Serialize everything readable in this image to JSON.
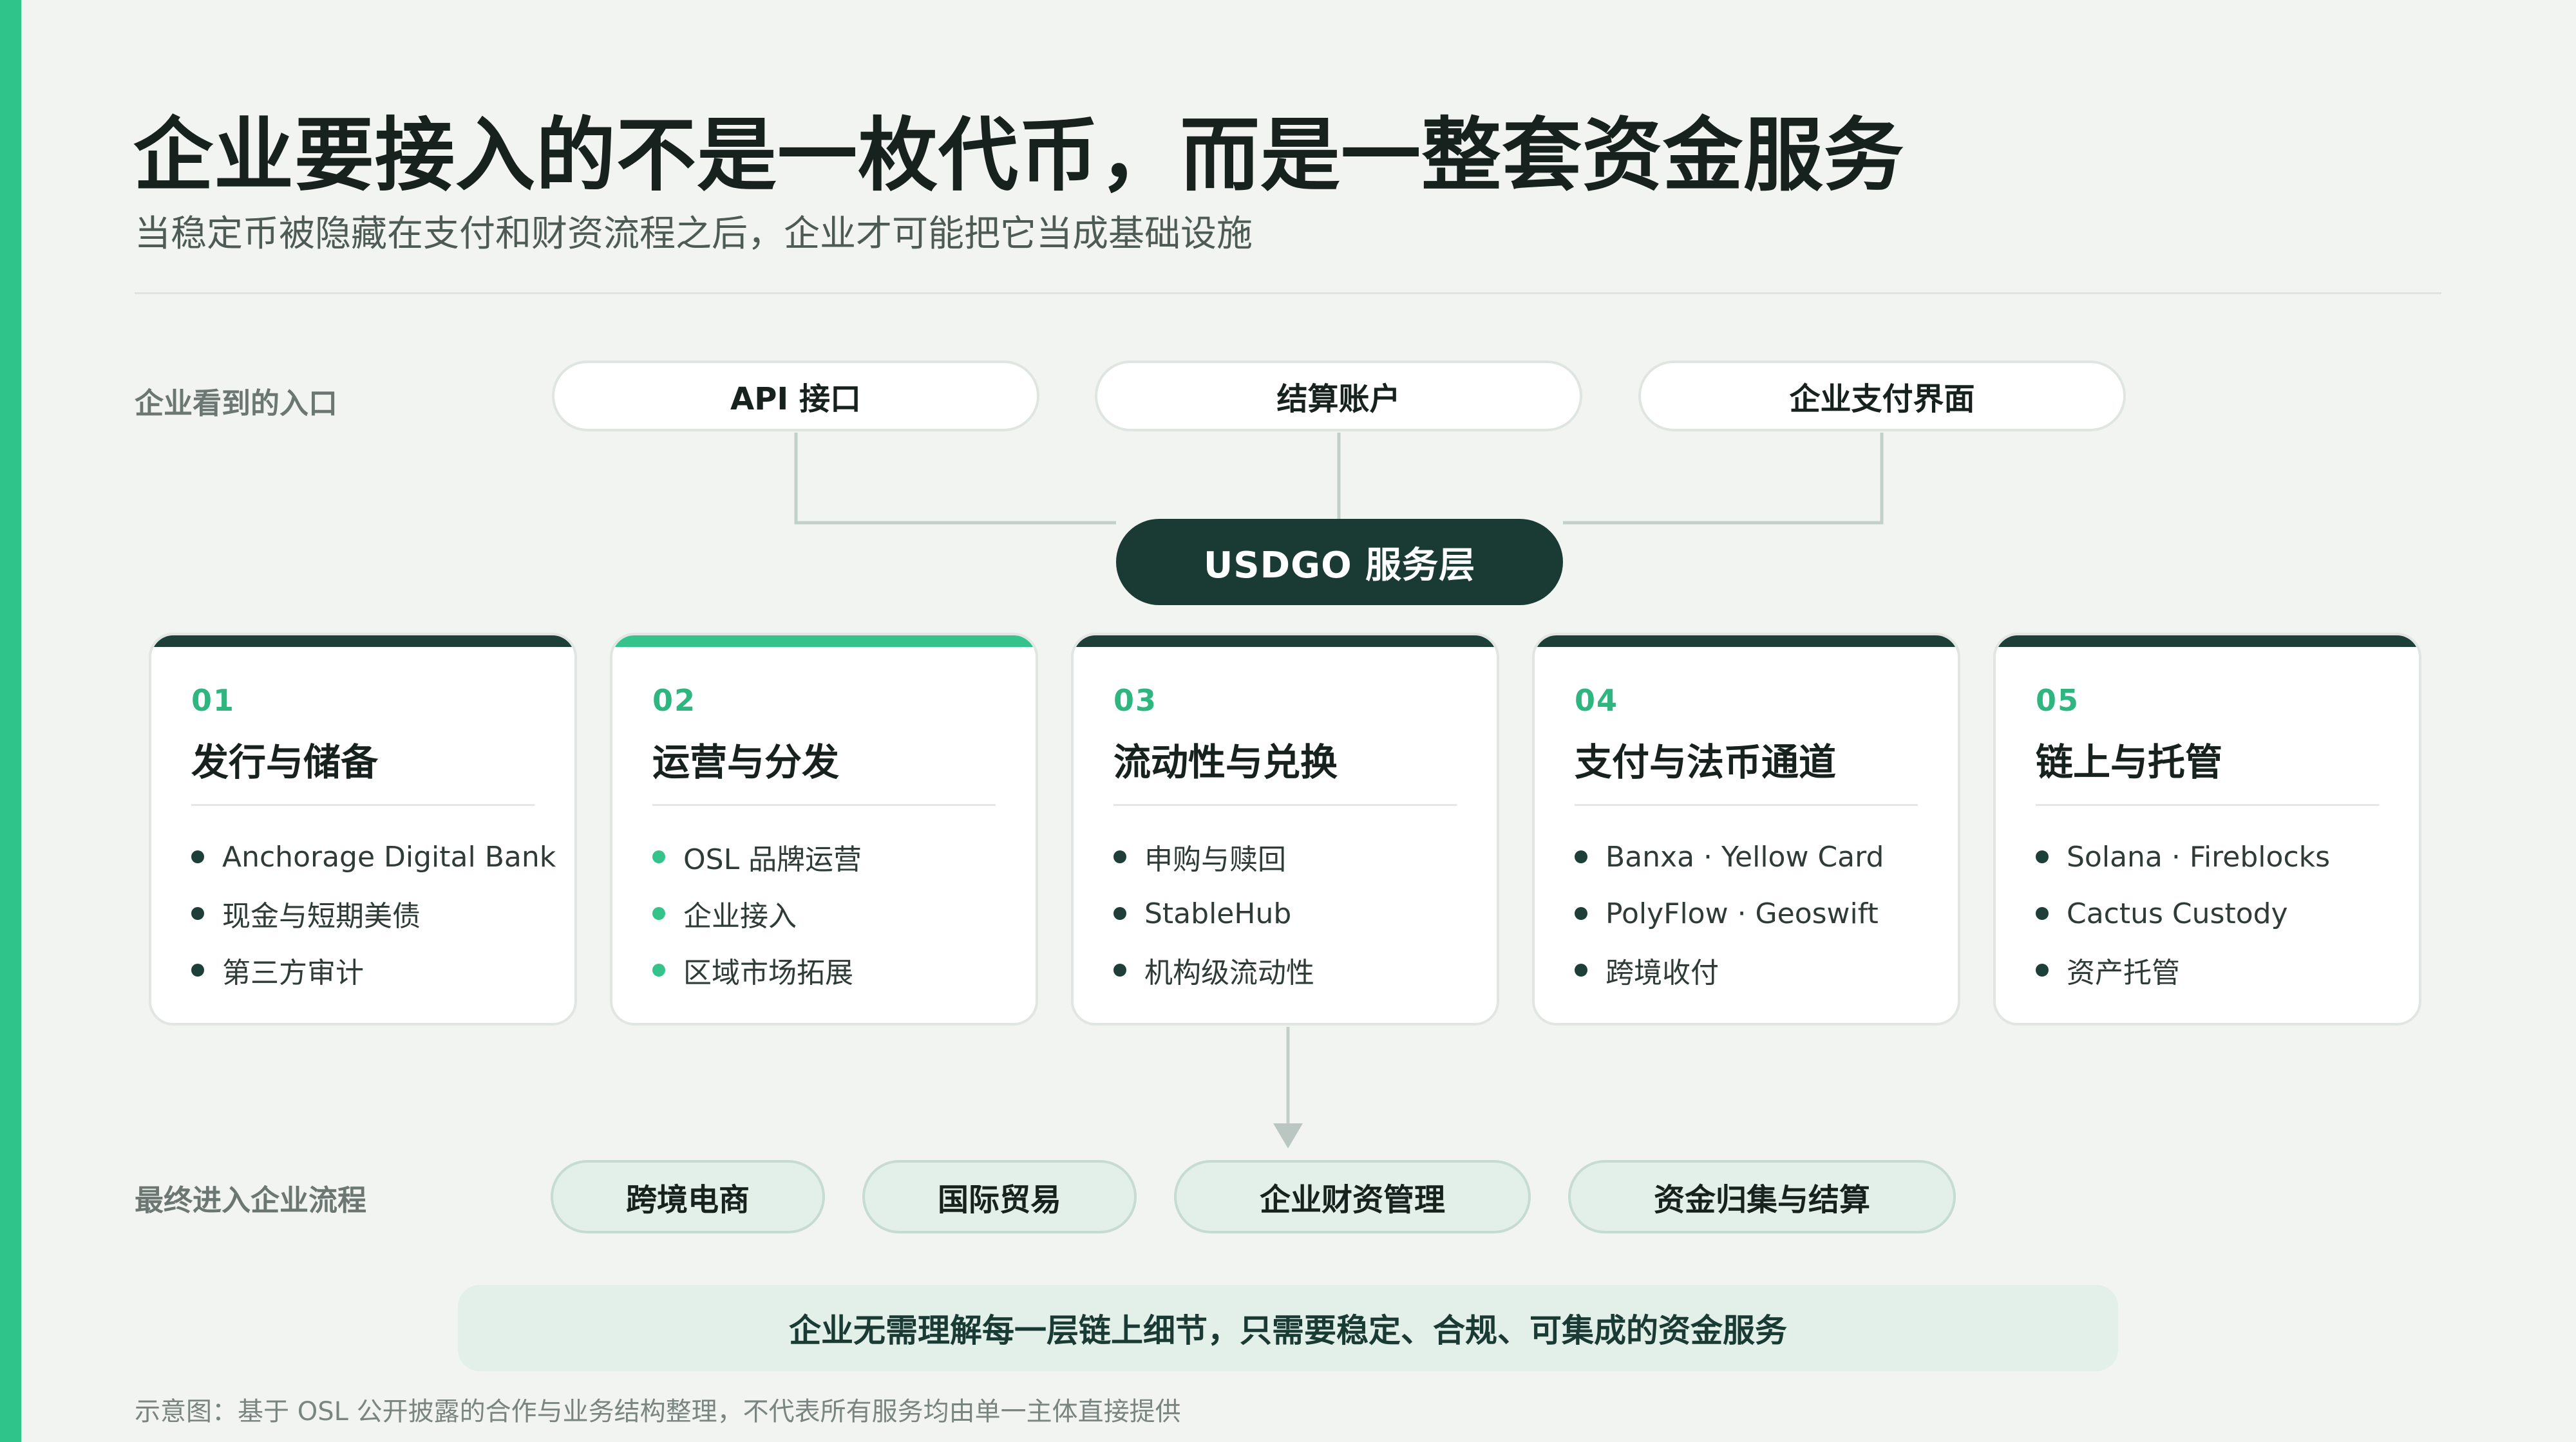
{
  "title": "企业要接入的不是一枚代币，而是一整套资金服务",
  "subtitle": "当稳定币被隐藏在支付和财资流程之后，企业才可能把它当成基础设施",
  "entry_row": {
    "label": "企业看到的入口",
    "items": [
      "API 接口",
      "结算账户",
      "企业支付界面"
    ]
  },
  "service_layer": "USDGO 服务层",
  "cards": [
    {
      "num": "01",
      "title": "发行与储备",
      "items": [
        "Anchorage Digital Bank",
        "现金与短期美债",
        "第三方审计"
      ]
    },
    {
      "num": "02",
      "title": "运营与分发",
      "items": [
        "OSL 品牌运营",
        "企业接入",
        "区域市场拓展"
      ]
    },
    {
      "num": "03",
      "title": "流动性与兑换",
      "items": [
        "申购与赎回",
        "StableHub",
        "机构级流动性"
      ]
    },
    {
      "num": "04",
      "title": "支付与法币通道",
      "items": [
        "Banxa · Yellow Card",
        "PolyFlow · Geoswift",
        "跨境收付"
      ]
    },
    {
      "num": "05",
      "title": "链上与托管",
      "items": [
        "Solana · Fireblocks",
        "Cactus Custody",
        "资产托管"
      ]
    }
  ],
  "flow_row": {
    "label": "最终进入企业流程",
    "items": [
      "跨境电商",
      "国际贸易",
      "企业财资管理",
      "资金归集与结算"
    ]
  },
  "note": "企业无需理解每一层链上细节，只需要稳定、合规、可集成的资金服务",
  "footer": "示意图：基于 OSL 公开披露的合作与业务结构整理，不代表所有服务均由单一主体直接提供",
  "colors": {
    "accent": "#2fc58a",
    "dark": "#1a3b33",
    "panel": "#e3efe9"
  }
}
